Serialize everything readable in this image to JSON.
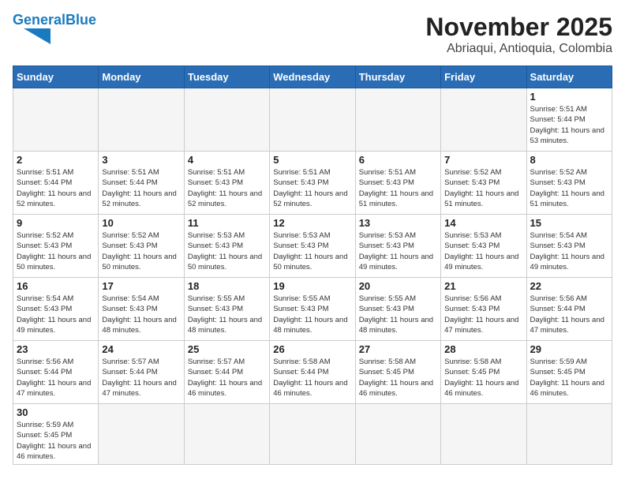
{
  "header": {
    "logo_general": "General",
    "logo_blue": "Blue",
    "month_title": "November 2025",
    "location": "Abriaqui, Antioquia, Colombia"
  },
  "days_of_week": [
    "Sunday",
    "Monday",
    "Tuesday",
    "Wednesday",
    "Thursday",
    "Friday",
    "Saturday"
  ],
  "weeks": [
    [
      {
        "day": "",
        "empty": true
      },
      {
        "day": "",
        "empty": true
      },
      {
        "day": "",
        "empty": true
      },
      {
        "day": "",
        "empty": true
      },
      {
        "day": "",
        "empty": true
      },
      {
        "day": "",
        "empty": true
      },
      {
        "day": "1",
        "sunrise": "5:51 AM",
        "sunset": "5:44 PM",
        "daylight": "11 hours and 53 minutes."
      }
    ],
    [
      {
        "day": "2",
        "sunrise": "5:51 AM",
        "sunset": "5:44 PM",
        "daylight": "11 hours and 52 minutes."
      },
      {
        "day": "3",
        "sunrise": "5:51 AM",
        "sunset": "5:44 PM",
        "daylight": "11 hours and 52 minutes."
      },
      {
        "day": "4",
        "sunrise": "5:51 AM",
        "sunset": "5:43 PM",
        "daylight": "11 hours and 52 minutes."
      },
      {
        "day": "5",
        "sunrise": "5:51 AM",
        "sunset": "5:43 PM",
        "daylight": "11 hours and 52 minutes."
      },
      {
        "day": "6",
        "sunrise": "5:51 AM",
        "sunset": "5:43 PM",
        "daylight": "11 hours and 51 minutes."
      },
      {
        "day": "7",
        "sunrise": "5:52 AM",
        "sunset": "5:43 PM",
        "daylight": "11 hours and 51 minutes."
      },
      {
        "day": "8",
        "sunrise": "5:52 AM",
        "sunset": "5:43 PM",
        "daylight": "11 hours and 51 minutes."
      }
    ],
    [
      {
        "day": "9",
        "sunrise": "5:52 AM",
        "sunset": "5:43 PM",
        "daylight": "11 hours and 50 minutes."
      },
      {
        "day": "10",
        "sunrise": "5:52 AM",
        "sunset": "5:43 PM",
        "daylight": "11 hours and 50 minutes."
      },
      {
        "day": "11",
        "sunrise": "5:53 AM",
        "sunset": "5:43 PM",
        "daylight": "11 hours and 50 minutes."
      },
      {
        "day": "12",
        "sunrise": "5:53 AM",
        "sunset": "5:43 PM",
        "daylight": "11 hours and 50 minutes."
      },
      {
        "day": "13",
        "sunrise": "5:53 AM",
        "sunset": "5:43 PM",
        "daylight": "11 hours and 49 minutes."
      },
      {
        "day": "14",
        "sunrise": "5:53 AM",
        "sunset": "5:43 PM",
        "daylight": "11 hours and 49 minutes."
      },
      {
        "day": "15",
        "sunrise": "5:54 AM",
        "sunset": "5:43 PM",
        "daylight": "11 hours and 49 minutes."
      }
    ],
    [
      {
        "day": "16",
        "sunrise": "5:54 AM",
        "sunset": "5:43 PM",
        "daylight": "11 hours and 49 minutes."
      },
      {
        "day": "17",
        "sunrise": "5:54 AM",
        "sunset": "5:43 PM",
        "daylight": "11 hours and 48 minutes."
      },
      {
        "day": "18",
        "sunrise": "5:55 AM",
        "sunset": "5:43 PM",
        "daylight": "11 hours and 48 minutes."
      },
      {
        "day": "19",
        "sunrise": "5:55 AM",
        "sunset": "5:43 PM",
        "daylight": "11 hours and 48 minutes."
      },
      {
        "day": "20",
        "sunrise": "5:55 AM",
        "sunset": "5:43 PM",
        "daylight": "11 hours and 48 minutes."
      },
      {
        "day": "21",
        "sunrise": "5:56 AM",
        "sunset": "5:43 PM",
        "daylight": "11 hours and 47 minutes."
      },
      {
        "day": "22",
        "sunrise": "5:56 AM",
        "sunset": "5:44 PM",
        "daylight": "11 hours and 47 minutes."
      }
    ],
    [
      {
        "day": "23",
        "sunrise": "5:56 AM",
        "sunset": "5:44 PM",
        "daylight": "11 hours and 47 minutes."
      },
      {
        "day": "24",
        "sunrise": "5:57 AM",
        "sunset": "5:44 PM",
        "daylight": "11 hours and 47 minutes."
      },
      {
        "day": "25",
        "sunrise": "5:57 AM",
        "sunset": "5:44 PM",
        "daylight": "11 hours and 46 minutes."
      },
      {
        "day": "26",
        "sunrise": "5:58 AM",
        "sunset": "5:44 PM",
        "daylight": "11 hours and 46 minutes."
      },
      {
        "day": "27",
        "sunrise": "5:58 AM",
        "sunset": "5:45 PM",
        "daylight": "11 hours and 46 minutes."
      },
      {
        "day": "28",
        "sunrise": "5:58 AM",
        "sunset": "5:45 PM",
        "daylight": "11 hours and 46 minutes."
      },
      {
        "day": "29",
        "sunrise": "5:59 AM",
        "sunset": "5:45 PM",
        "daylight": "11 hours and 46 minutes."
      }
    ],
    [
      {
        "day": "30",
        "sunrise": "5:59 AM",
        "sunset": "5:45 PM",
        "daylight": "11 hours and 46 minutes."
      },
      {
        "day": "",
        "empty": true
      },
      {
        "day": "",
        "empty": true
      },
      {
        "day": "",
        "empty": true
      },
      {
        "day": "",
        "empty": true
      },
      {
        "day": "",
        "empty": true
      },
      {
        "day": "",
        "empty": true
      }
    ]
  ]
}
